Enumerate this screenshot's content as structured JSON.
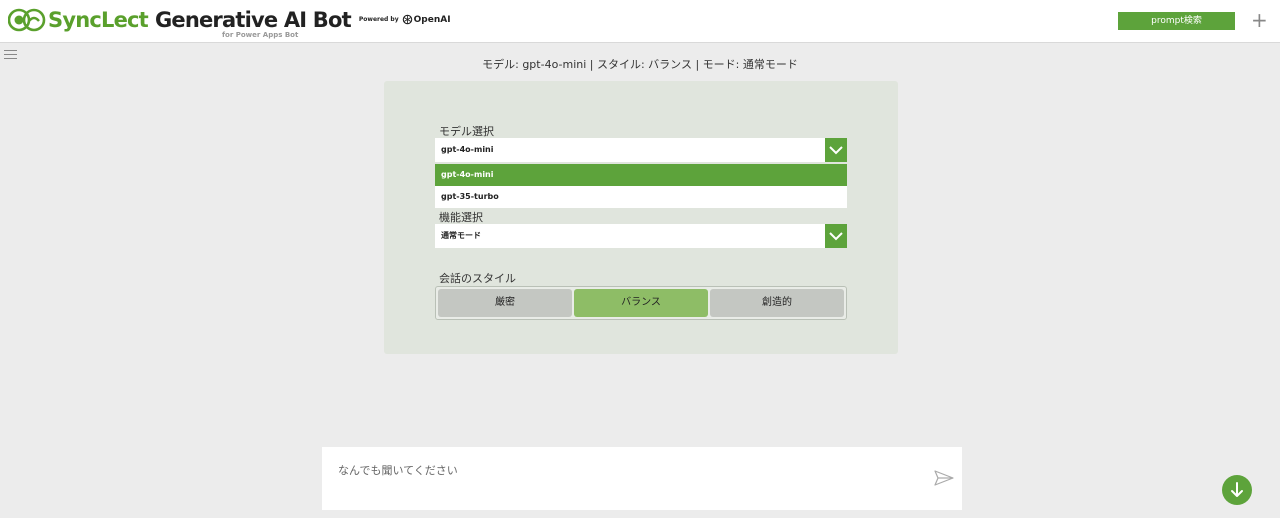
{
  "header": {
    "brand_sync": "SyncLect",
    "brand_gen": "Generative AI Bot",
    "powered_by": "Powered by",
    "openai": "OpenAI",
    "subbrand": "for Power Apps Bot",
    "prompt_button": "prompt検索"
  },
  "status": "モデル: gpt-4o-mini | スタイル: バランス | モード: 通常モード",
  "settings": {
    "model_label": "モデル選択",
    "model_value": "gpt-4o-mini",
    "model_options": [
      "gpt-4o-mini",
      "gpt-35-turbo"
    ],
    "mode_label": "機能選択",
    "mode_value": "通常モード",
    "style_label": "会話のスタイル",
    "styles": [
      "厳密",
      "バランス",
      "創造的"
    ],
    "active_style": "バランス"
  },
  "chat": {
    "placeholder": "なんでも聞いてください"
  },
  "colors": {
    "accent": "#5da33b",
    "active_style": "#8ebd66",
    "panel": "#e0e5dd"
  }
}
